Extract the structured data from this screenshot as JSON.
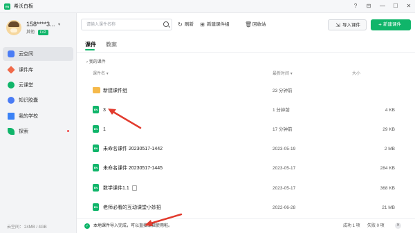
{
  "app": {
    "logo_text": "EN",
    "title": "希沃白板"
  },
  "window_controls": [
    "?",
    "⊟",
    "—",
    "☐",
    "✕"
  ],
  "user": {
    "name": "158****3...",
    "role": "其他",
    "level": "LV2"
  },
  "sidebar": {
    "items": [
      {
        "label": "云空间",
        "icon": "cloud-icon",
        "color": "#4a7cf5",
        "active": true
      },
      {
        "label": "课件库",
        "icon": "gem-icon",
        "color": "#f06a4a",
        "active": false
      },
      {
        "label": "云课堂",
        "icon": "circle-play-icon",
        "color": "#10b56a",
        "active": false
      },
      {
        "label": "知识胶囊",
        "icon": "capsule-icon",
        "color": "#4a7cf5",
        "active": false
      },
      {
        "label": "我的学校",
        "icon": "school-icon",
        "color": "#3b82f6",
        "active": false
      },
      {
        "label": "探索",
        "icon": "rocket-icon",
        "color": "#10b56a",
        "active": false,
        "dot": true
      }
    ],
    "storage_label": "云空间：",
    "storage_value": "24MB / 4GB"
  },
  "toolbar": {
    "search_placeholder": "请输入课件名称",
    "refresh_label": "刷新",
    "new_group_label": "新建课件组",
    "recycle_label": "回收站",
    "import_label": "导入课件",
    "new_label": "新建课件"
  },
  "tabs": [
    {
      "label": "课件",
      "active": true
    },
    {
      "label": "教案",
      "active": false
    }
  ],
  "list": {
    "group_label": "我的课件",
    "columns": {
      "name": "课件名",
      "time": "最新时间",
      "size": "大小"
    },
    "rows": [
      {
        "type": "folder",
        "name": "新建课件组",
        "time": "23 分钟前",
        "size": ""
      },
      {
        "type": "file",
        "name": "3",
        "time": "1 分钟前",
        "size": "4 KB"
      },
      {
        "type": "file",
        "name": "1",
        "time": "17 分钟前",
        "size": "29 KB"
      },
      {
        "type": "file",
        "name": "未命名课件 20230517-1442",
        "time": "2023-05-19",
        "size": "2 MB"
      },
      {
        "type": "file",
        "name": "未命名课件 20230517-1445",
        "time": "2023-05-17",
        "size": "284 KB"
      },
      {
        "type": "file",
        "name": "数学课件1.1",
        "time": "2023-05-17",
        "size": "368 KB",
        "attach": true
      },
      {
        "type": "file",
        "name": "老师必看的互动课堂小妙招",
        "time": "2022-06-28",
        "size": "21 MB"
      }
    ]
  },
  "status": {
    "message": "本地课件导入完成，可以直接编辑使用啦。",
    "success": "成功 1 项",
    "fail": "失败 0 项"
  },
  "colors": {
    "accent": "#10b56a",
    "annotation_arrow": "#e23b2e"
  }
}
